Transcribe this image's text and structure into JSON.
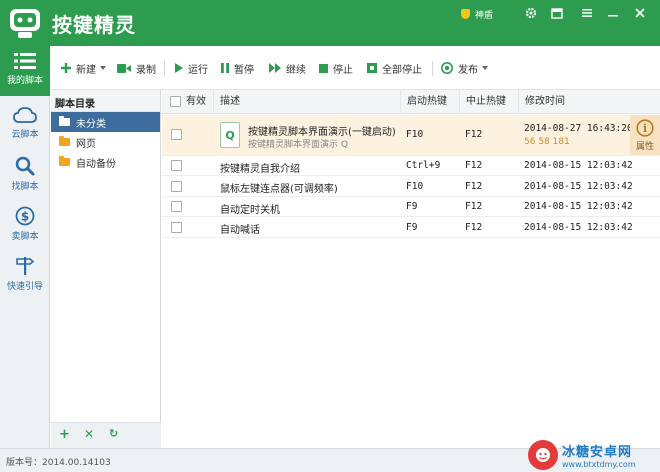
{
  "app": {
    "title": "按键精灵",
    "user": "神盾"
  },
  "sidebar": {
    "items": [
      {
        "label": "我的脚本",
        "icon": "list-icon"
      },
      {
        "label": "云脚本",
        "icon": "cloud-icon"
      },
      {
        "label": "找脚本",
        "icon": "search-icon"
      },
      {
        "label": "卖脚本",
        "icon": "dollar-icon"
      },
      {
        "label": "快速引导",
        "icon": "signpost-icon"
      }
    ]
  },
  "toolbar": {
    "new": "新建",
    "record": "录制",
    "run": "运行",
    "pause": "暂停",
    "resume": "继续",
    "stop": "停止",
    "stop_all": "全部停止",
    "publish": "发布"
  },
  "directory": {
    "title": "脚本目录",
    "folders": [
      "未分类",
      "网页",
      "自动备份"
    ],
    "selected": 0
  },
  "table": {
    "columns": {
      "enabled": "有效",
      "desc": "描述",
      "start_key": "启动热键",
      "stop_key": "中止热键",
      "modified": "修改时间"
    },
    "rows": [
      {
        "title": "按键精灵脚本界面演示(一键启动)",
        "subtitle": "按键精灵脚本界面演示 Q",
        "start_key": "F10",
        "stop_key": "F12",
        "modified": "2014-08-27 16:43:20",
        "modified_sub": "56 58 181",
        "highlight": true
      },
      {
        "title": "按键精灵自我介绍",
        "start_key": "Ctrl+9",
        "stop_key": "F12",
        "modified": "2014-08-15 12:03:42"
      },
      {
        "title": "鼠标左键连点器(可调频率)",
        "start_key": "F10",
        "stop_key": "F12",
        "modified": "2014-08-15 12:03:42"
      },
      {
        "title": "自动定时关机",
        "start_key": "F9",
        "stop_key": "F12",
        "modified": "2014-08-15 12:03:42"
      },
      {
        "title": "自动喊话",
        "start_key": "F9",
        "stop_key": "F12",
        "modified": "2014-08-15 12:03:42"
      }
    ],
    "property_label": "属性"
  },
  "status": {
    "version": "版本号：2014.00.14103"
  },
  "watermark": {
    "main": "冰糖安卓网",
    "sub": "www.btxtdmy.com"
  },
  "colors": {
    "brand": "#2e9c4f",
    "selection": "#3d6d9c",
    "highlight_row": "#fdf1e0"
  }
}
